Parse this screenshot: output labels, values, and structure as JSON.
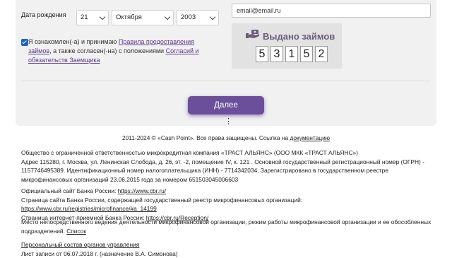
{
  "form": {
    "dob_label": "Дата рождения",
    "dob_day": "21",
    "dob_month": "Октября",
    "dob_year": "2003",
    "email_value": "email@email.ru",
    "consent_prefix": "Я ознакомлен(-а) и принимаю ",
    "consent_link1": "Правила предоставления займов",
    "consent_middle": ", а также согласен(-на) с положениями ",
    "consent_link2": "Согласий и обязательств Заемщика",
    "captcha_title": "Выдано займов",
    "captcha_digits": [
      "5",
      "3",
      "1",
      "5",
      "2"
    ],
    "next_button": "Далее"
  },
  "footer": {
    "copyright_text": "2011-2024 © «Cash Point». Все права защищены. Ссылка на ",
    "copyright_link": "документацию",
    "company_line1": "Общество с ограниченной ответственностью микрокредитная компания «ТРАСТ АЛЬЯНС» (ООО МКК «ТРАСТ АЛЬЯНС»)",
    "company_line2": "Адрес 115280, г. Москва, ул. Ленинская Слобода, д. 26, эт. -2, помещение IV, к. 121 . Основной государственный регистрационный номер (ОГРН) - 1157746495389. Идентификационный номер налогоплательщика (ИНН) - 7714342034. Зарегистрировано в государственном реестре микрофинансовых организаций 23.06.2015 года за номером 651503045006603",
    "cbr_label": "Официальный сайт Банка России: ",
    "cbr_link": "https://www.cbr.ru/",
    "registry_label": "Страница сайта Банка России, содержащей государственный реестр микрофинансовых организаций: ",
    "registry_link": "https://www.cbr.ru/registries/microfinance/#a_14199",
    "reception_label": "Страница интернет-приемной Банка России: ",
    "reception_link": "https://cbr.ru/Reception/",
    "location_text": "Место непосредственного ведения деятельности микрофинансовой организации, режим работы микрофинансовой организации и ее обособленных подразделений. ",
    "location_link": "Список",
    "staff_link": "Персональный состав органов управления",
    "record_sheet": "Лист записи от 06.07.2018 г. (назначение В.А. Симонова)"
  }
}
